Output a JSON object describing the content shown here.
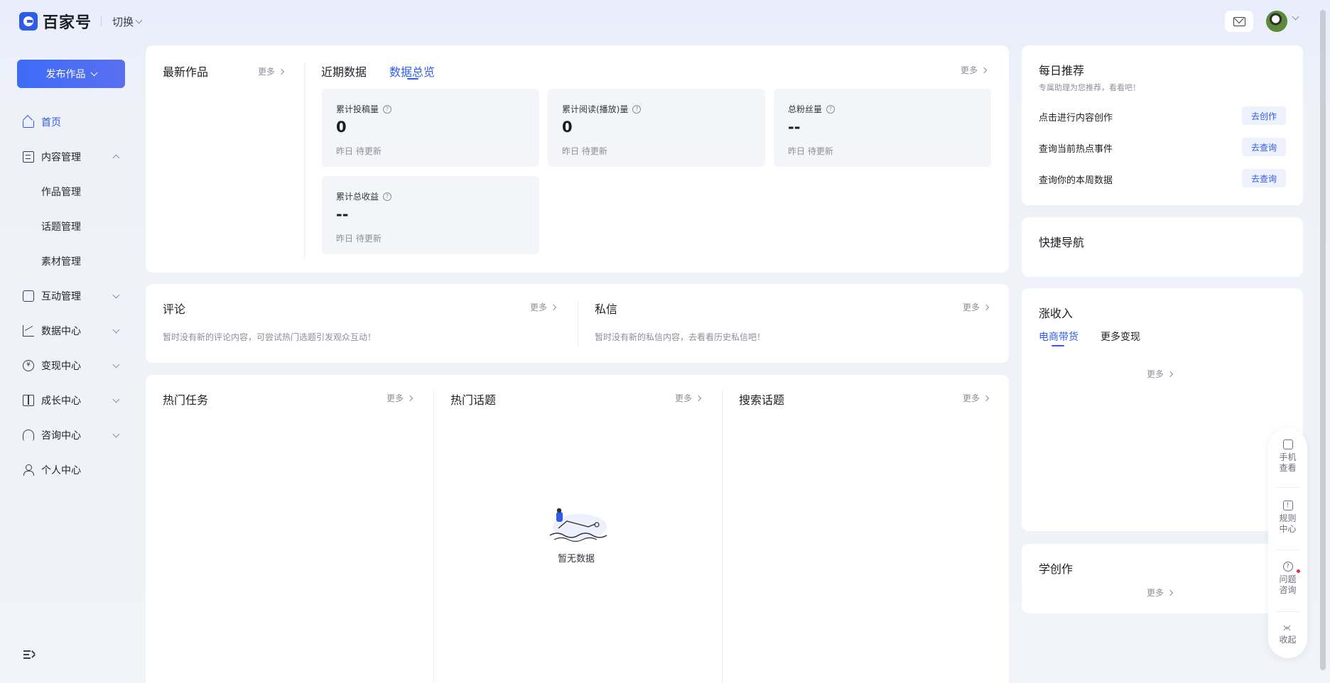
{
  "brand": {
    "name": "百家号",
    "switch_label": "切换"
  },
  "sidebar": {
    "publish_label": "发布作品",
    "items": [
      {
        "label": "首页",
        "icon": "home-icon"
      },
      {
        "label": "内容管理",
        "icon": "document-icon"
      },
      {
        "label": "作品管理"
      },
      {
        "label": "话题管理"
      },
      {
        "label": "素材管理"
      },
      {
        "label": "互动管理",
        "icon": "chat-icon"
      },
      {
        "label": "数据中心",
        "icon": "chart-icon"
      },
      {
        "label": "变现中心",
        "icon": "coin-icon"
      },
      {
        "label": "成长中心",
        "icon": "book-icon"
      },
      {
        "label": "咨询中心",
        "icon": "headset-icon"
      },
      {
        "label": "个人中心",
        "icon": "user-icon"
      }
    ]
  },
  "more_label": "更多",
  "latest": {
    "title": "最新作品"
  },
  "data_tabs": [
    {
      "label": "近期数据"
    },
    {
      "label": "数据总览"
    }
  ],
  "stats": [
    {
      "label": "累计投稿量",
      "value": "0",
      "sub": "昨日 待更新"
    },
    {
      "label": "累计阅读(播放)量",
      "value": "0",
      "sub": "昨日 待更新"
    },
    {
      "label": "总粉丝量",
      "value": "--",
      "sub": "昨日 待更新"
    },
    {
      "label": "累计总收益",
      "value": "--",
      "sub": "昨日 待更新"
    }
  ],
  "comments": {
    "title": "评论",
    "empty": "暂时没有新的评论内容，可尝试热门选题引发观众互动！"
  },
  "messages": {
    "title": "私信",
    "empty": "暂时没有新的私信内容，去看看历史私信吧！"
  },
  "hot": {
    "tasks_title": "热门任务",
    "topics_title": "热门话题",
    "search_title": "搜索话题",
    "no_data": "暂无数据"
  },
  "daily": {
    "title": "每日推荐",
    "subtitle": "专属助理为您推荐，看看吧！",
    "items": [
      {
        "label": "点击进行内容创作",
        "action": "去创作"
      },
      {
        "label": "查询当前热点事件",
        "action": "去查询"
      },
      {
        "label": "查询你的本周数据",
        "action": "去查询"
      }
    ]
  },
  "quick_nav": {
    "title": "快捷导航"
  },
  "income": {
    "title": "涨收入",
    "tabs": [
      {
        "label": "电商带货"
      },
      {
        "label": "更多变现"
      }
    ]
  },
  "learn": {
    "title": "学创作"
  },
  "float_tools": [
    {
      "label": "手机查看",
      "icon": "phone-icon"
    },
    {
      "label": "规则中心",
      "icon": "rules-icon"
    },
    {
      "label": "问题咨询",
      "icon": "help-icon"
    },
    {
      "label": "收起",
      "icon": "collapse-up-icon"
    }
  ]
}
